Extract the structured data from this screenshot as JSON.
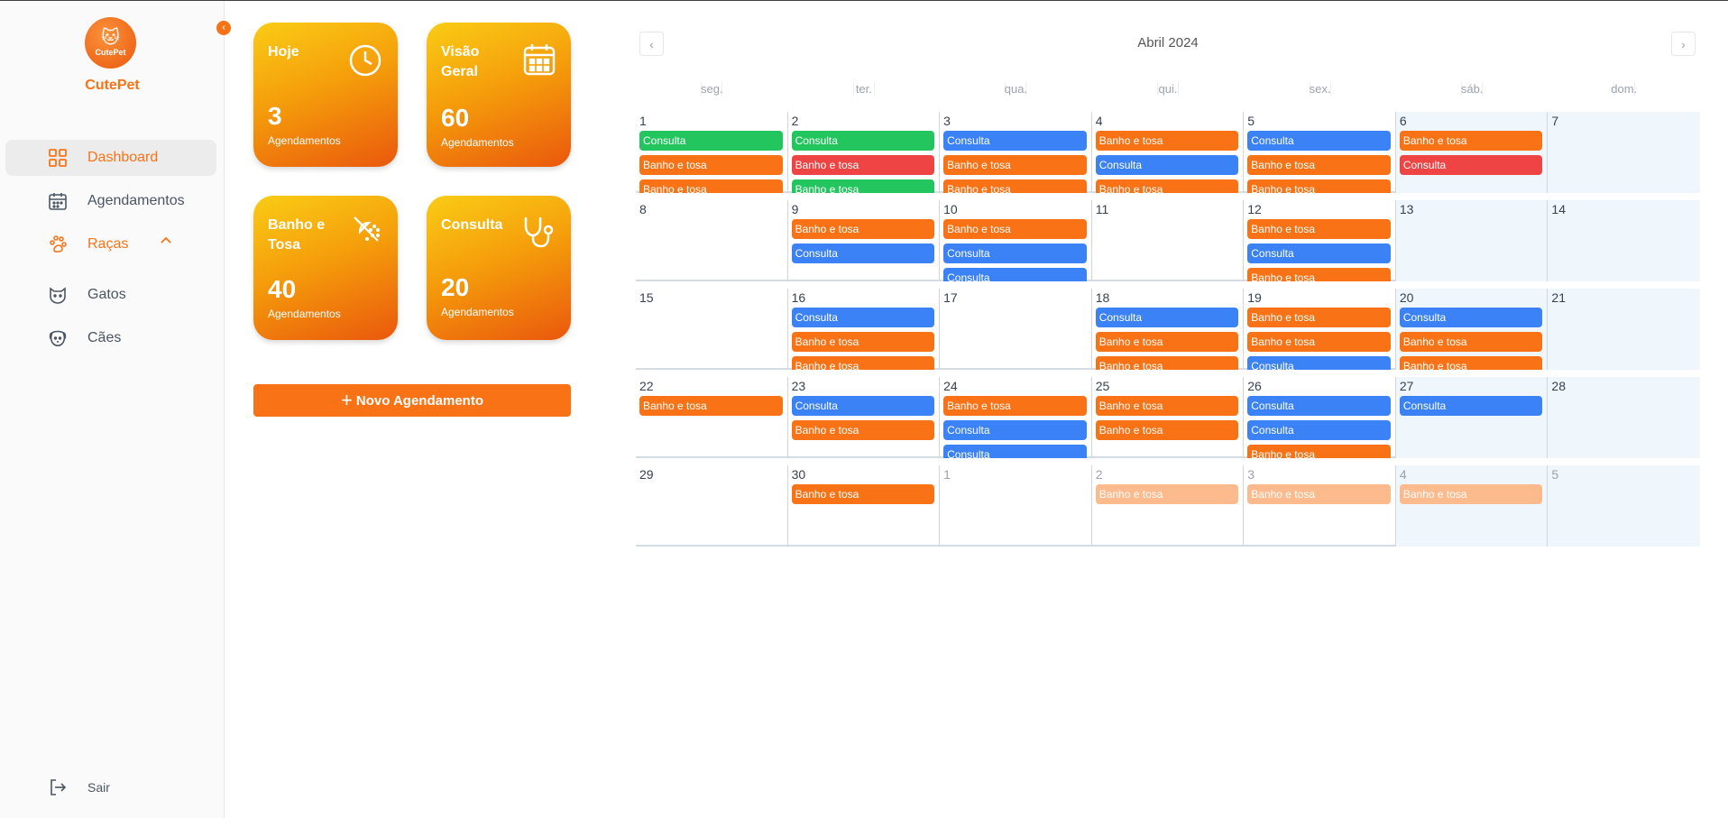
{
  "sidebar": {
    "logo_text": "CutePet",
    "brand": "CutePet",
    "items": [
      {
        "label": "Dashboard",
        "icon": "grid-icon"
      },
      {
        "label": "Agendamentos",
        "icon": "calendar-icon"
      },
      {
        "label": "Raças",
        "icon": "paw-icon"
      },
      {
        "label": "Gatos",
        "icon": "cat-icon"
      },
      {
        "label": "Cães",
        "icon": "dog-icon"
      }
    ],
    "logout": "Sair"
  },
  "cards": [
    {
      "title": "Hoje",
      "value": "3",
      "sub": "Agendamentos",
      "icon": "clock-icon"
    },
    {
      "title": "Visão Geral",
      "value": "60",
      "sub": "Agendamentos",
      "icon": "calendar-grid-icon"
    },
    {
      "title": "Banho e Tosa",
      "value": "40",
      "sub": "Agendamentos",
      "icon": "shower-icon"
    },
    {
      "title": "Consulta",
      "value": "20",
      "sub": "Agendamentos",
      "icon": "stethoscope-icon"
    }
  ],
  "new_button": "Novo Agendamento",
  "calendar": {
    "title": "Abril 2024",
    "weekdays": [
      "seg.",
      "ter.",
      "qua.",
      "qui.",
      "sex.",
      "sáb.",
      "dom."
    ],
    "colors": {
      "green": "#22c55e",
      "orange": "#f97316",
      "blue": "#3b82f6",
      "red": "#ef4444",
      "orange_faded": "#fdba8c"
    },
    "weeks": [
      [
        {
          "d": "1",
          "ev": [
            [
              "Consulta",
              "green"
            ],
            [
              "Banho e tosa",
              "orange"
            ],
            [
              "Banho e tosa",
              "orange"
            ]
          ]
        },
        {
          "d": "2",
          "ev": [
            [
              "Consulta",
              "green"
            ],
            [
              "Banho e tosa",
              "red"
            ],
            [
              "Banho e tosa",
              "green"
            ]
          ]
        },
        {
          "d": "3",
          "ev": [
            [
              "Consulta",
              "blue"
            ],
            [
              "Banho e tosa",
              "orange"
            ],
            [
              "Banho e tosa",
              "orange"
            ]
          ]
        },
        {
          "d": "4",
          "ev": [
            [
              "Banho e tosa",
              "orange"
            ],
            [
              "Consulta",
              "blue"
            ],
            [
              "Banho e tosa",
              "orange"
            ]
          ]
        },
        {
          "d": "5",
          "ev": [
            [
              "Consulta",
              "blue"
            ],
            [
              "Banho e tosa",
              "orange"
            ],
            [
              "Banho e tosa",
              "orange"
            ]
          ]
        },
        {
          "d": "6",
          "ev": [
            [
              "Banho e tosa",
              "orange"
            ],
            [
              "Consulta",
              "red"
            ]
          ]
        },
        {
          "d": "7",
          "ev": []
        }
      ],
      [
        {
          "d": "8",
          "ev": []
        },
        {
          "d": "9",
          "ev": [
            [
              "Banho e tosa",
              "orange"
            ],
            [
              "Consulta",
              "blue"
            ]
          ]
        },
        {
          "d": "10",
          "ev": [
            [
              "Banho e tosa",
              "orange"
            ],
            [
              "Consulta",
              "blue"
            ],
            [
              "Consulta",
              "blue"
            ]
          ]
        },
        {
          "d": "11",
          "ev": []
        },
        {
          "d": "12",
          "ev": [
            [
              "Banho e tosa",
              "orange"
            ],
            [
              "Consulta",
              "blue"
            ],
            [
              "Banho e tosa",
              "orange"
            ]
          ]
        },
        {
          "d": "13",
          "ev": []
        },
        {
          "d": "14",
          "ev": []
        }
      ],
      [
        {
          "d": "15",
          "ev": []
        },
        {
          "d": "16",
          "ev": [
            [
              "Consulta",
              "blue"
            ],
            [
              "Banho e tosa",
              "orange"
            ],
            [
              "Banho e tosa",
              "orange"
            ]
          ]
        },
        {
          "d": "17",
          "ev": []
        },
        {
          "d": "18",
          "ev": [
            [
              "Consulta",
              "blue"
            ],
            [
              "Banho e tosa",
              "orange"
            ],
            [
              "Banho e tosa",
              "orange"
            ]
          ]
        },
        {
          "d": "19",
          "ev": [
            [
              "Banho e tosa",
              "orange"
            ],
            [
              "Banho e tosa",
              "orange"
            ],
            [
              "Consulta",
              "blue"
            ]
          ]
        },
        {
          "d": "20",
          "ev": [
            [
              "Consulta",
              "blue"
            ],
            [
              "Banho e tosa",
              "orange"
            ],
            [
              "Banho e tosa",
              "orange"
            ]
          ]
        },
        {
          "d": "21",
          "ev": []
        }
      ],
      [
        {
          "d": "22",
          "ev": [
            [
              "Banho e tosa",
              "orange"
            ]
          ]
        },
        {
          "d": "23",
          "ev": [
            [
              "Consulta",
              "blue"
            ],
            [
              "Banho e tosa",
              "orange"
            ]
          ]
        },
        {
          "d": "24",
          "ev": [
            [
              "Banho e tosa",
              "orange"
            ],
            [
              "Consulta",
              "blue"
            ],
            [
              "Consulta",
              "blue"
            ]
          ]
        },
        {
          "d": "25",
          "ev": [
            [
              "Banho e tosa",
              "orange"
            ],
            [
              "Banho e tosa",
              "orange"
            ]
          ]
        },
        {
          "d": "26",
          "ev": [
            [
              "Consulta",
              "blue"
            ],
            [
              "Consulta",
              "blue"
            ],
            [
              "Banho e tosa",
              "orange"
            ]
          ]
        },
        {
          "d": "27",
          "ev": [
            [
              "Consulta",
              "blue"
            ]
          ]
        },
        {
          "d": "28",
          "ev": []
        }
      ],
      [
        {
          "d": "29",
          "ev": []
        },
        {
          "d": "30",
          "ev": [
            [
              "Banho e tosa",
              "orange"
            ]
          ]
        },
        {
          "d": "1",
          "other": true,
          "ev": []
        },
        {
          "d": "2",
          "other": true,
          "ev": [
            [
              "Banho e tosa",
              "orange_faded"
            ]
          ]
        },
        {
          "d": "3",
          "other": true,
          "ev": [
            [
              "Banho e tosa",
              "orange_faded"
            ]
          ]
        },
        {
          "d": "4",
          "other": true,
          "ev": [
            [
              "Banho e tosa",
              "orange_faded"
            ]
          ]
        },
        {
          "d": "5",
          "other": true,
          "ev": []
        }
      ]
    ]
  }
}
